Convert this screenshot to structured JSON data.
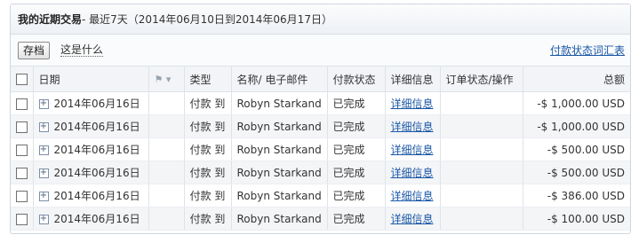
{
  "header": {
    "title": "我的近期交易",
    "subtitle": " - 最近7天（2014年06月10日到2014年06月17日）"
  },
  "toolbar": {
    "archive_label": "存档",
    "what_label": "这是什么",
    "legend_link": "付款状态词汇表"
  },
  "table": {
    "columns": {
      "date": "日期",
      "type": "类型",
      "name": "名称/ 电子邮件",
      "status": "付款状态",
      "details": "详细信息",
      "order": "订单状态/操作",
      "total": "总额"
    },
    "flag_icon": "flag-icon",
    "rows": [
      {
        "date": "2014年06月16日",
        "type": "付款 到",
        "name": "Robyn Starkand",
        "status": "已完成",
        "details": "详细信息",
        "total": "-$ 1,000.00 USD"
      },
      {
        "date": "2014年06月16日",
        "type": "付款 到",
        "name": "Robyn Starkand",
        "status": "已完成",
        "details": "详细信息",
        "total": "-$ 1,000.00 USD"
      },
      {
        "date": "2014年06月16日",
        "type": "付款 到",
        "name": "Robyn Starkand",
        "status": "已完成",
        "details": "详细信息",
        "total": "-$ 500.00 USD"
      },
      {
        "date": "2014年06月16日",
        "type": "付款 到",
        "name": "Robyn Starkand",
        "status": "已完成",
        "details": "详细信息",
        "total": "-$ 500.00 USD"
      },
      {
        "date": "2014年06月16日",
        "type": "付款 到",
        "name": "Robyn Starkand",
        "status": "已完成",
        "details": "详细信息",
        "total": "-$ 386.00 USD"
      },
      {
        "date": "2014年06月16日",
        "type": "付款 到",
        "name": "Robyn Starkand",
        "status": "已完成",
        "details": "详细信息",
        "total": "-$ 100.00 USD"
      }
    ]
  },
  "colors": {
    "link": "#1a58a7",
    "header_bg": "#eef1f5",
    "row_alt": "#f4f5f7"
  }
}
